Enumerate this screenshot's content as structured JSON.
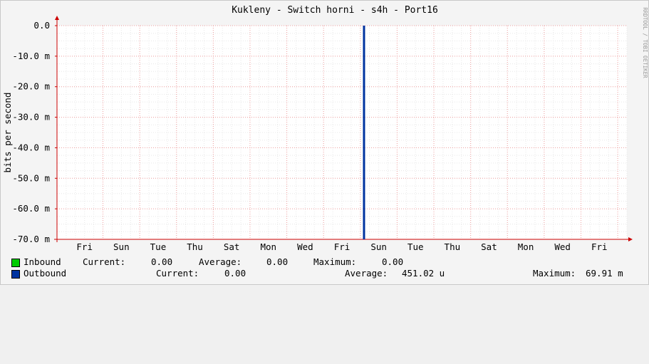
{
  "title": "Kukleny - Switch horni - s4h - Port16",
  "watermark": "RRDTOOL / TOBI OETIKER",
  "chart_data": {
    "type": "line",
    "title": "Kukleny - Switch horni - s4h - Port16",
    "ylabel": "bits per second",
    "xlabel": "",
    "ylim": [
      -0.07,
      0
    ],
    "y_ticks": [
      0,
      -0.01,
      -0.02,
      -0.03,
      -0.04,
      -0.05,
      -0.06,
      -0.07
    ],
    "y_tick_labels": [
      "0.0",
      "-10.0 m",
      "-20.0 m",
      "-30.0 m",
      "-40.0 m",
      "-50.0 m",
      "-60.0 m",
      "-70.0 m"
    ],
    "x_tick_labels": [
      "Fri",
      "Sun",
      "Tue",
      "Thu",
      "Sat",
      "Mon",
      "Wed",
      "Fri",
      "Sun",
      "Tue",
      "Thu",
      "Sat",
      "Mon",
      "Wed",
      "Fri"
    ],
    "x_range_days": [
      0,
      31
    ],
    "x_tick_days": [
      1.5,
      3.5,
      5.5,
      7.5,
      9.5,
      11.5,
      13.5,
      15.5,
      17.5,
      19.5,
      21.5,
      23.5,
      25.5,
      27.5,
      29.5
    ],
    "grid": true,
    "series": [
      {
        "name": "Inbound",
        "color": "#00cc00",
        "points": []
      },
      {
        "name": "Outbound",
        "color": "#0033a0",
        "spike_day": 16.7,
        "value": -0.07
      }
    ]
  },
  "legend": {
    "inbound": {
      "name": "Inbound",
      "current_label": "Current:",
      "current": "0.00",
      "average_label": "Average:",
      "average": "0.00",
      "maximum_label": "Maximum:",
      "maximum": "0.00",
      "color": "#00cc00"
    },
    "outbound": {
      "name": "Outbound",
      "current_label": "Current:",
      "current": "0.00",
      "average_label": "Average:",
      "average": "451.02 u",
      "maximum_label": "Maximum:",
      "maximum": "69.91 m",
      "color": "#0033a0"
    }
  }
}
